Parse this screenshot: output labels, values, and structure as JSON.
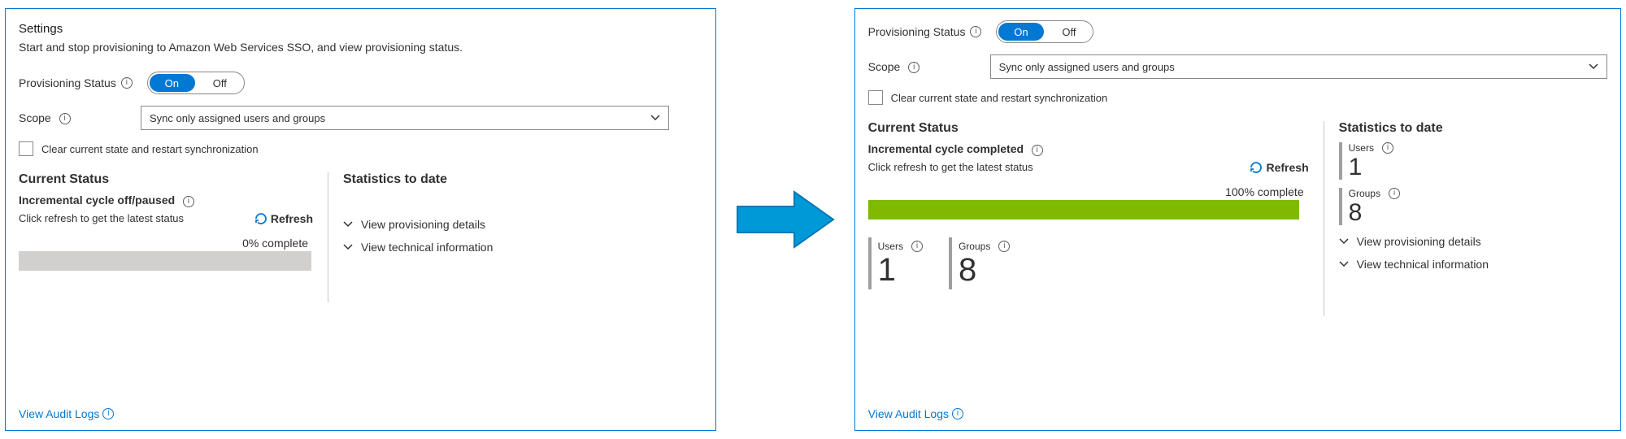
{
  "left": {
    "title": "Settings",
    "subtitle": "Start and stop provisioning to Amazon Web Services SSO, and view provisioning status.",
    "provisioning_label": "Provisioning Status",
    "toggle_on": "On",
    "toggle_off": "Off",
    "toggle_selected": "On",
    "scope_label": "Scope",
    "scope_value": "Sync only assigned users and groups",
    "clear_label": "Clear current state and restart synchronization",
    "clear_checked": false,
    "current_status_heading": "Current Status",
    "status_line": "Incremental cycle off/paused",
    "refresh_hint": "Click refresh to get the latest status",
    "refresh_label": "Refresh",
    "progress_text": "0% complete",
    "progress_percent": 0,
    "stats_heading": "Statistics to date",
    "expand_provisioning": "View provisioning details",
    "expand_technical": "View technical information",
    "audit_link": "View Audit Logs"
  },
  "right": {
    "provisioning_label": "Provisioning Status",
    "toggle_on": "On",
    "toggle_off": "Off",
    "toggle_selected": "On",
    "scope_label": "Scope",
    "scope_value": "Sync only assigned users and groups",
    "clear_label": "Clear current state and restart synchronization",
    "clear_checked": false,
    "current_status_heading": "Current Status",
    "status_line": "Incremental cycle completed",
    "refresh_hint": "Click refresh to get the latest status",
    "refresh_label": "Refresh",
    "progress_text": "100% complete",
    "progress_percent": 100,
    "stats_heading": "Statistics to date",
    "stat_users_label": "Users",
    "stat_users_value": "1",
    "stat_groups_label": "Groups",
    "stat_groups_value": "8",
    "expand_provisioning": "View provisioning details",
    "expand_technical": "View technical information",
    "audit_link": "View Audit Logs"
  },
  "colors": {
    "accent": "#0078d4",
    "success": "#7fba00"
  }
}
